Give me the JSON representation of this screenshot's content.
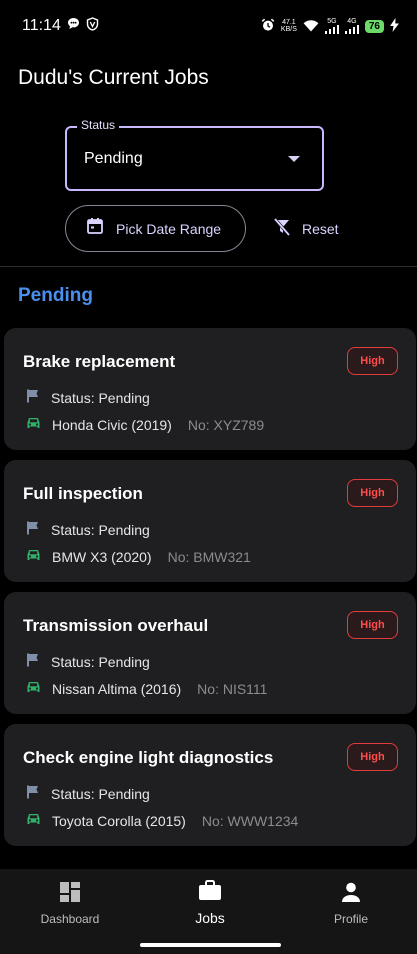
{
  "status_bar": {
    "time": "11:14",
    "net_speed_top": "47.1",
    "net_speed_bottom": "KB/S",
    "signal_1": "5G",
    "signal_2": "4G",
    "battery": "76"
  },
  "page": {
    "title": "Dudu's Current Jobs"
  },
  "filters": {
    "status_label": "Status",
    "status_value": "Pending",
    "date_button": "Pick Date Range",
    "reset_button": "Reset"
  },
  "section": {
    "title": "Pending"
  },
  "jobs": [
    {
      "title": "Brake replacement",
      "priority": "High",
      "status": "Status: Pending",
      "vehicle": "Honda Civic (2019)",
      "plate": "No: XYZ789"
    },
    {
      "title": "Full inspection",
      "priority": "High",
      "status": "Status: Pending",
      "vehicle": "BMW X3 (2020)",
      "plate": "No: BMW321"
    },
    {
      "title": "Transmission overhaul",
      "priority": "High",
      "status": "Status: Pending",
      "vehicle": "Nissan Altima (2016)",
      "plate": "No: NIS111"
    },
    {
      "title": "Check engine light diagnostics",
      "priority": "High",
      "status": "Status: Pending",
      "vehicle": "Toyota Corolla (2015)",
      "plate": "No: WWW1234"
    }
  ],
  "nav": {
    "items": [
      {
        "label": "Dashboard",
        "icon": "dashboard-icon"
      },
      {
        "label": "Jobs",
        "icon": "briefcase-icon"
      },
      {
        "label": "Profile",
        "icon": "person-icon"
      }
    ],
    "active": "Jobs"
  },
  "colors": {
    "accent": "#4a90f0",
    "outline": "#c9b8ff",
    "priority_high": "#e03c3c",
    "vehicle_icon": "#2fb36b",
    "flag_icon": "#7f8fa8",
    "card_bg": "#1f1f22"
  }
}
